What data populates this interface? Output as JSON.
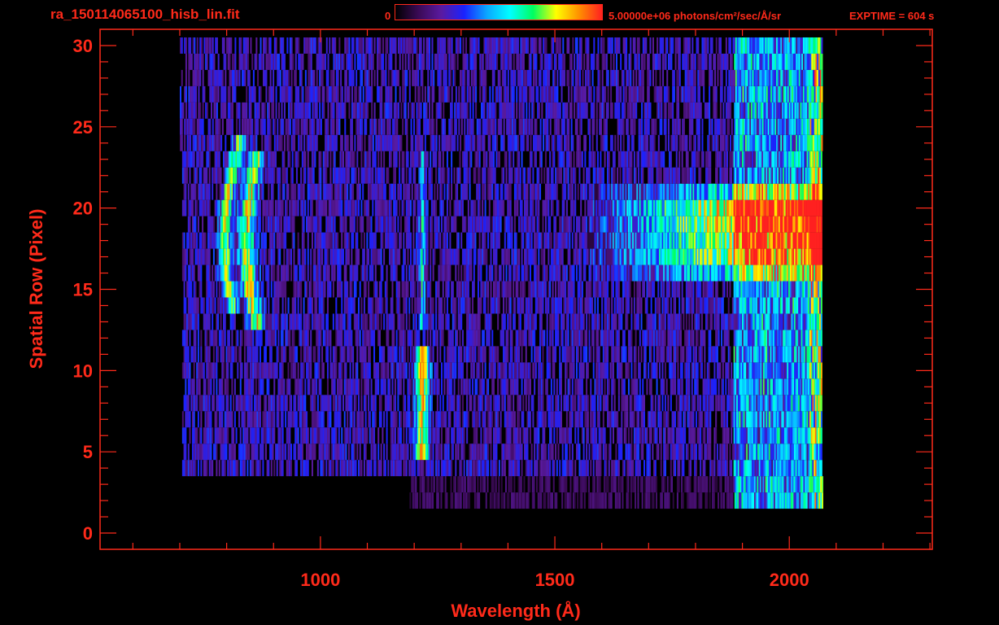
{
  "header": {
    "filename": "ra_150114065100_hisb_lin.fit",
    "colorbar_min_label": "0",
    "colorbar_max_label": "5.00000e+06 photons/cm²/sec/Å/sr",
    "exptime_label": "EXPTIME = 604 s"
  },
  "colors": {
    "axis": "#ff2a1a",
    "background": "#000000",
    "colormap": [
      "#000000",
      "#3a0a55",
      "#5a1aa0",
      "#1a22ff",
      "#0aa8ff",
      "#00ffff",
      "#00ff60",
      "#ffff00",
      "#ff9000",
      "#ff2020"
    ]
  },
  "chart_data": {
    "type": "heatmap",
    "title": "ra_150114065100_hisb_lin.fit",
    "xlabel": "Wavelength (Å)",
    "ylabel": "Spatial Row (Pixel)",
    "xlim": [
      530,
      2305
    ],
    "ylim": [
      -1,
      31
    ],
    "x_ticks": [
      1000,
      1500,
      2000
    ],
    "y_ticks": [
      0,
      5,
      10,
      15,
      20,
      25,
      30
    ],
    "colorbar": {
      "min": 0,
      "max": 5000000,
      "units": "photons/cm²/sec/Å/sr"
    },
    "exptime_s": 604,
    "data_extent": {
      "wavelength": [
        700,
        2070
      ],
      "rows": [
        2,
        30
      ]
    },
    "features": [
      {
        "name": "arc 1",
        "wavelength_range": [
          770,
          870
        ],
        "rows": [
          14,
          24
        ],
        "peak_intensity": 0.55
      },
      {
        "name": "arc 2",
        "wavelength_range": [
          820,
          930
        ],
        "rows": [
          13,
          23
        ],
        "peak_intensity": 0.6
      },
      {
        "name": "Ly-alpha upper",
        "wavelength": 1216,
        "rows": [
          13,
          23
        ],
        "peak_intensity": 0.35
      },
      {
        "name": "Ly-alpha lower",
        "wavelength": 1216,
        "rows": [
          5,
          11
        ],
        "peak_intensity": 0.62
      },
      {
        "name": "continuum band",
        "wavelength_range": [
          1680,
          2060
        ],
        "rows": [
          16,
          21
        ],
        "peak_intensity": 0.6
      }
    ]
  }
}
